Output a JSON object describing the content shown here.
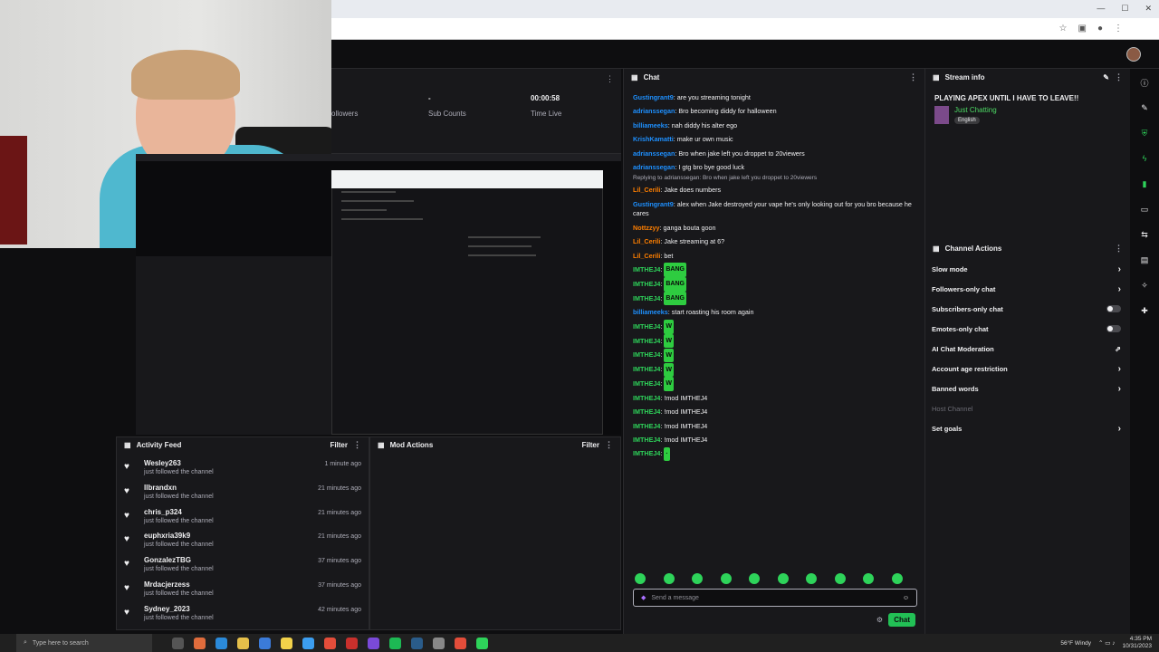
{
  "stats": {
    "followers_label": "ollowers",
    "sub_counts_value": "-",
    "sub_counts_label": "Sub Counts",
    "time_live_value": "00:00:58",
    "time_live_label": "Time Live"
  },
  "activity_feed": {
    "title": "Activity Feed",
    "filter": "Filter",
    "items": [
      {
        "name": "Wesley263",
        "action": "just followed the channel",
        "time": "1 minute ago"
      },
      {
        "name": "llbrandxn",
        "action": "just followed the channel",
        "time": "21 minutes ago"
      },
      {
        "name": "chris_p324",
        "action": "just followed the channel",
        "time": "21 minutes ago"
      },
      {
        "name": "euphxria39k9",
        "action": "just followed the channel",
        "time": "21 minutes ago"
      },
      {
        "name": "GonzalezTBG",
        "action": "just followed the channel",
        "time": "37 minutes ago"
      },
      {
        "name": "Mrdacjerzess",
        "action": "just followed the channel",
        "time": "37 minutes ago"
      },
      {
        "name": "Sydney_2023",
        "action": "just followed the channel",
        "time": "42 minutes ago"
      }
    ]
  },
  "mod_actions": {
    "title": "Mod Actions",
    "filter": "Filter"
  },
  "chat": {
    "title": "Chat",
    "placeholder": "Send a message",
    "send_label": "Chat",
    "lines": [
      {
        "user": "Gustingrant9",
        "color": "#1e90ff",
        "text": ": are you streaming tonight"
      },
      {
        "user": "adrianssegan",
        "color": "#1e90ff",
        "text": ": Bro becoming diddy for halloween"
      },
      {
        "user": "billiameeks",
        "color": "#1e90ff",
        "text": ": nah diddy his alter ego"
      },
      {
        "user": "KrishKamatti",
        "color": "#1e90ff",
        "text": ": make ur own music"
      },
      {
        "user": "adrianssegan",
        "color": "#1e90ff",
        "text": ": Bro when jake left you droppet to 20viewers"
      },
      {
        "user": "adrianssegan",
        "color": "#1e90ff",
        "text": ": I gtg bro bye good luck"
      },
      {
        "user": "",
        "color": "#adadb8",
        "text": "Replying to adrianssegan: Bro when jake left you droppet to 20viewers",
        "reply": true
      },
      {
        "user": "Lil_Cerili",
        "color": "#ff7f00",
        "text": ": Jake does numbers"
      },
      {
        "user": "Gustingrant9",
        "color": "#1e90ff",
        "text": ": alex when Jake destroyed your vape he's only looking out for you bro because he cares",
        "wrap": true
      },
      {
        "user": "Nottzzyy",
        "color": "#ff7f00",
        "text": ": ganga bouta goon"
      },
      {
        "user": "Lil_Cerili",
        "color": "#ff7f00",
        "text": ": Jake streaming at 6?"
      },
      {
        "user": "Lil_Cerili",
        "color": "#ff7f00",
        "text": ": bet"
      },
      {
        "user": "IMTHEJ4",
        "color": "#2ed35a",
        "text": ": ",
        "emote": "BANG"
      },
      {
        "user": "IMTHEJ4",
        "color": "#2ed35a",
        "text": ": ",
        "emote": "BANG"
      },
      {
        "user": "IMTHEJ4",
        "color": "#2ed35a",
        "text": ": ",
        "emote": "BANG"
      },
      {
        "user": "billiameeks",
        "color": "#1e90ff",
        "text": ": start roasting his room again"
      },
      {
        "user": "IMTHEJ4",
        "color": "#2ed35a",
        "text": ": ",
        "emote": "W"
      },
      {
        "user": "IMTHEJ4",
        "color": "#2ed35a",
        "text": ": ",
        "emote": "W"
      },
      {
        "user": "IMTHEJ4",
        "color": "#2ed35a",
        "text": ": ",
        "emote": "W"
      },
      {
        "user": "IMTHEJ4",
        "color": "#2ed35a",
        "text": ": ",
        "emote": "W"
      },
      {
        "user": "IMTHEJ4",
        "color": "#2ed35a",
        "text": ": ",
        "emote": "W"
      },
      {
        "user": "IMTHEJ4",
        "color": "#2ed35a",
        "text": ": !mod IMTHEJ4"
      },
      {
        "user": "IMTHEJ4",
        "color": "#2ed35a",
        "text": ": !mod IMTHEJ4"
      },
      {
        "user": "IMTHEJ4",
        "color": "#2ed35a",
        "text": ": !mod IMTHEJ4"
      },
      {
        "user": "IMTHEJ4",
        "color": "#2ed35a",
        "text": ": !mod IMTHEJ4"
      },
      {
        "user": "IMTHEJ4",
        "color": "#2ed35a",
        "text": ": ",
        "emote": "·"
      }
    ]
  },
  "stream_info": {
    "title": "Stream info",
    "stream_title": "PLAYING APEX UNTIL I HAVE TO LEAVE!!",
    "category": "Just Chatting",
    "language": "English"
  },
  "channel_actions": {
    "title": "Channel Actions",
    "items": [
      {
        "label": "Slow mode",
        "control": "arrow"
      },
      {
        "label": "Followers-only chat",
        "control": "arrow"
      },
      {
        "label": "Subscribers-only chat",
        "control": "toggle"
      },
      {
        "label": "Emotes-only chat",
        "control": "toggle"
      },
      {
        "label": "AI Chat Moderation",
        "control": "external"
      },
      {
        "label": "Account age restriction",
        "control": "arrow"
      },
      {
        "label": "Banned words",
        "control": "arrow"
      },
      {
        "label": "Host Channel",
        "control": "none"
      },
      {
        "label": "Set goals",
        "control": "arrow"
      }
    ]
  },
  "taskbar": {
    "search_placeholder": "Type here to search",
    "weather": "56°F Windy",
    "time": "4:35 PM",
    "date": "10/31/2023"
  }
}
